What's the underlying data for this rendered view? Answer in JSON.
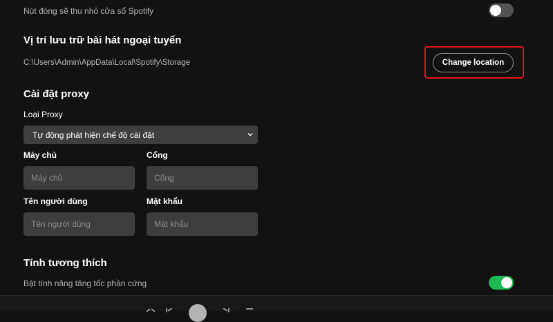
{
  "close_behavior": {
    "label": "Nút đóng sẽ thu nhỏ cửa sổ Spotify",
    "enabled": false
  },
  "offline_storage": {
    "title": "Vị trí lưu trữ bài hát ngoại tuyến",
    "path": "C:\\Users\\Admin\\AppData\\Local\\Spotify\\Storage",
    "change_button": "Change location"
  },
  "proxy": {
    "title": "Cài đặt proxy",
    "type_label": "Loại Proxy",
    "type_value": "Tự động phát hiện chế độ cài đặt",
    "host_label": "Máy chủ",
    "host_placeholder": "Máy chủ",
    "port_label": "Cổng",
    "port_placeholder": "Cổng",
    "username_label": "Tên người dùng",
    "username_placeholder": "Tên người dùng",
    "password_label": "Mật khẩu",
    "password_placeholder": "Mật khẩu"
  },
  "compatibility": {
    "title": "Tính tương thích",
    "hw_accel_label": "Bật tính năng tăng tốc phần cứng",
    "hw_accel_enabled": true
  },
  "colors": {
    "background": "#121212",
    "accent_green": "#1db954",
    "highlight_red": "#e3141d"
  }
}
